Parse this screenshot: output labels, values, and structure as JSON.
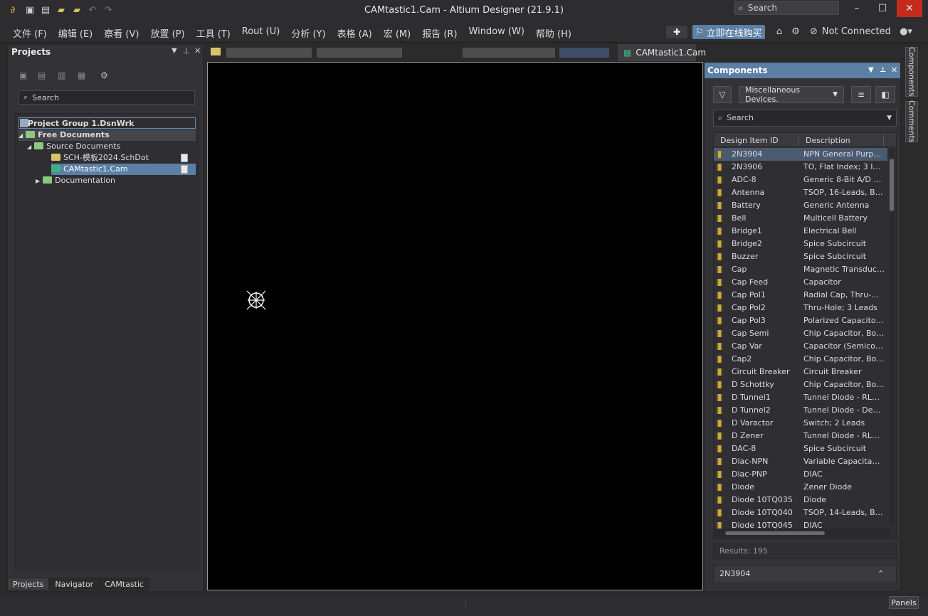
{
  "window": {
    "title": "CAMtastic1.Cam - Altium Designer (21.9.1)",
    "search_placeholder": "Search"
  },
  "menus": [
    "文件 (F)",
    "编辑 (E)",
    "察看 (V)",
    "放置 (P)",
    "工具 (T)",
    "Rout (U)",
    "分析 (Y)",
    "表格 (A)",
    "宏 (M)",
    "报告 (R)",
    "Window (W)",
    "帮助 (H)"
  ],
  "toolbar": {
    "promo_label": "立即在线购买",
    "connection_status": "Not Connected"
  },
  "projects": {
    "title": "Projects",
    "search_placeholder": "Search",
    "tree": {
      "group": "Project Group 1.DsnWrk",
      "free_docs": "Free Documents",
      "source_docs": "Source Documents",
      "file1": "SCH-模板2024.SchDot",
      "file2": "CAMtastic1.Cam",
      "documentation": "Documentation"
    },
    "tabs": [
      "Projects",
      "Navigator",
      "CAMtastic"
    ]
  },
  "doc_tab": {
    "active_label": "CAMtastic1.Cam"
  },
  "components": {
    "title": "Components",
    "library": "Miscellaneous Devices.",
    "search_placeholder": "Search",
    "col_id": "Design Item ID",
    "col_desc": "Description",
    "rows": [
      [
        "2N3904",
        "NPN General Purpos..."
      ],
      [
        "2N3906",
        "TO, Flat Index; 3 In-L..."
      ],
      [
        "ADC-8",
        "Generic 8-Bit A/D Co..."
      ],
      [
        "Antenna",
        "TSOP, 16-Leads, Bod..."
      ],
      [
        "Battery",
        "Generic Antenna"
      ],
      [
        "Bell",
        "Multicell Battery"
      ],
      [
        "Bridge1",
        "Electrical Bell"
      ],
      [
        "Bridge2",
        "Spice Subcircuit"
      ],
      [
        "Buzzer",
        "Spice Subcircuit"
      ],
      [
        "Cap",
        "Magnetic Transduce..."
      ],
      [
        "Cap Feed",
        "Capacitor"
      ],
      [
        "Cap Pol1",
        "Radial Cap, Thru-Ho..."
      ],
      [
        "Cap Pol2",
        "Thru-Hole; 3 Leads"
      ],
      [
        "Cap Pol3",
        "Polarized Capacitor..."
      ],
      [
        "Cap Semi",
        "Chip Capacitor, Bod..."
      ],
      [
        "Cap Var",
        "Capacitor (Semicon..."
      ],
      [
        "Cap2",
        "Chip Capacitor, Bod..."
      ],
      [
        "Circuit Breaker",
        "Circuit Breaker"
      ],
      [
        "D Schottky",
        "Chip Capacitor, Bod..."
      ],
      [
        "D Tunnel1",
        "Tunnel Diode - RLC..."
      ],
      [
        "D Tunnel2",
        "Tunnel Diode - Dep..."
      ],
      [
        "D Varactor",
        "Switch; 2 Leads"
      ],
      [
        "D Zener",
        "Tunnel Diode - RLC..."
      ],
      [
        "DAC-8",
        "Spice Subcircuit"
      ],
      [
        "Diac-NPN",
        "Variable Capacitanc..."
      ],
      [
        "Diac-PNP",
        "DIAC"
      ],
      [
        "Diode",
        "Zener Diode"
      ],
      [
        "Diode 10TQ035",
        "Diode"
      ],
      [
        "Diode 10TQ040",
        "TSOP, 14-Leads, Bod..."
      ],
      [
        "Diode 10TQ045",
        "DIAC"
      ]
    ],
    "results": "Results: 195",
    "selected": "2N3904"
  },
  "side_tabs": [
    "Components",
    "Comments"
  ],
  "status": {
    "panels_label": "Panels"
  }
}
